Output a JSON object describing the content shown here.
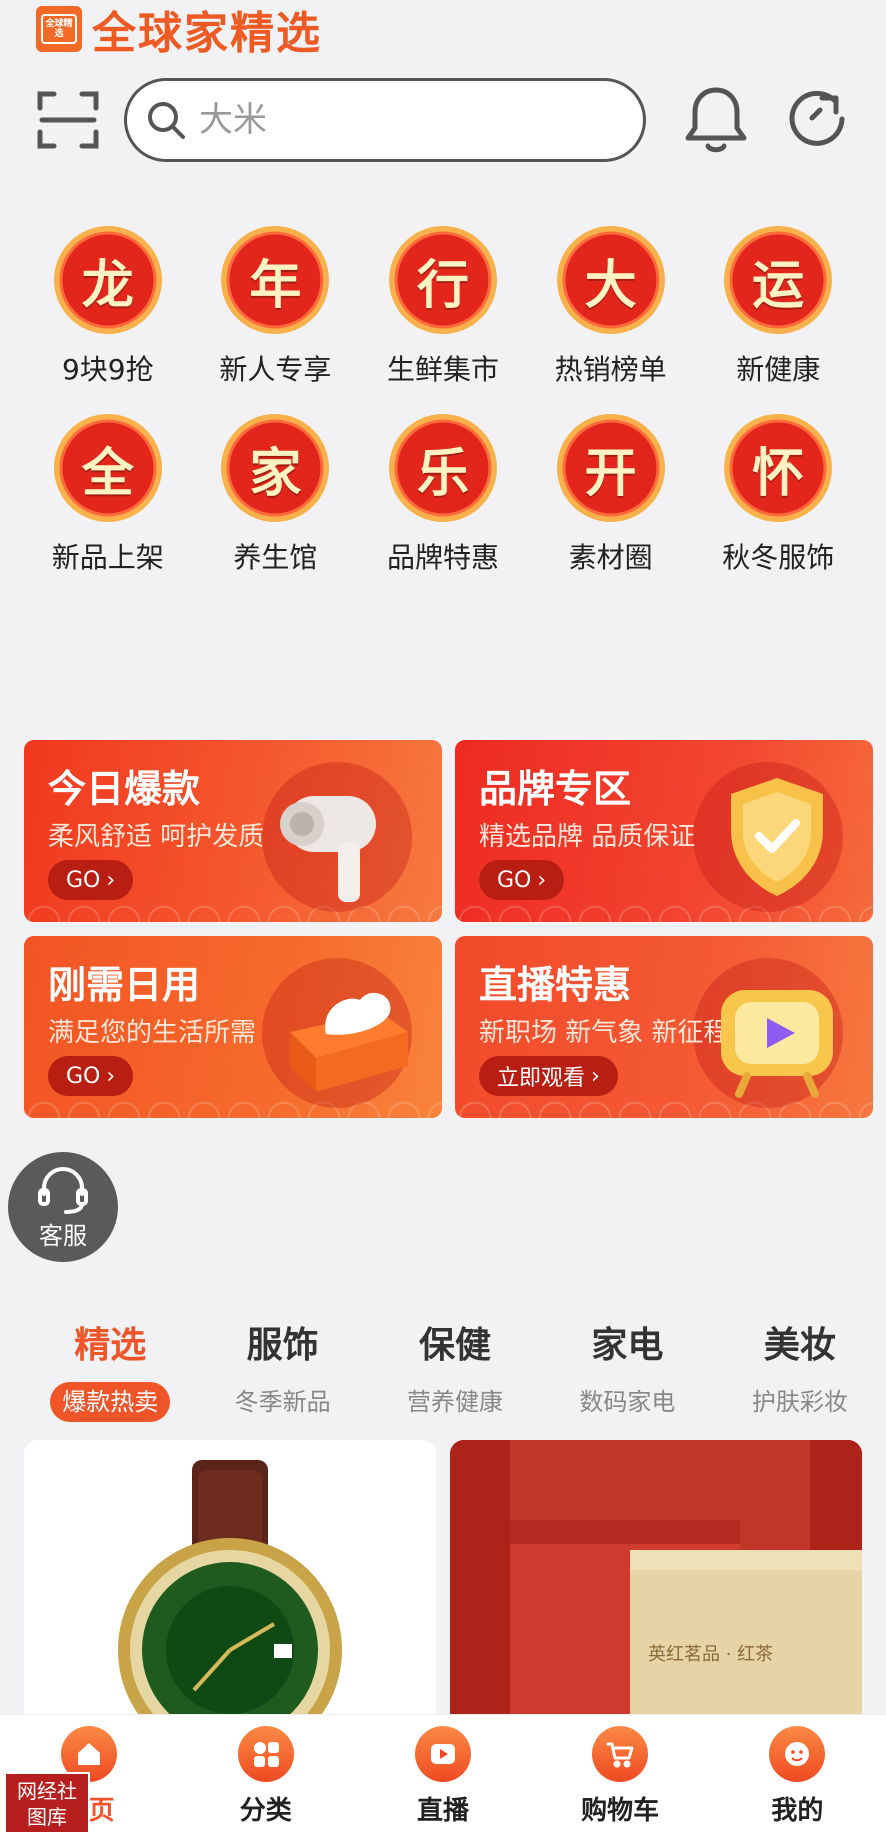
{
  "header": {
    "brand_logo_text": "全球精选",
    "brand_title": "全球家精选",
    "search_placeholder": "大米"
  },
  "categories": [
    {
      "char": "龙",
      "label": "9块9抢"
    },
    {
      "char": "年",
      "label": "新人专享"
    },
    {
      "char": "行",
      "label": "生鲜集市"
    },
    {
      "char": "大",
      "label": "热销榜单"
    },
    {
      "char": "运",
      "label": "新健康"
    },
    {
      "char": "全",
      "label": "新品上架"
    },
    {
      "char": "家",
      "label": "养生馆"
    },
    {
      "char": "乐",
      "label": "品牌特惠"
    },
    {
      "char": "开",
      "label": "素材圈"
    },
    {
      "char": "怀",
      "label": "秋冬服饰"
    }
  ],
  "promos": [
    {
      "title": "今日爆款",
      "subtitle": "柔风舒适 呵护发质",
      "button": "GO",
      "image_icon": "hair-dryer-icon"
    },
    {
      "title": "品牌专区",
      "subtitle": "精选品牌 品质保证",
      "button": "GO",
      "image_icon": "shield-check-icon"
    },
    {
      "title": "刚需日用",
      "subtitle": "满足您的生活所需",
      "button": "GO",
      "image_icon": "tissue-box-icon"
    },
    {
      "title": "直播特惠",
      "subtitle": "新职场 新气象 新征程",
      "button": "立即观看",
      "image_icon": "tv-play-icon"
    }
  ],
  "service": {
    "label": "客服"
  },
  "tabs": [
    {
      "title": "精选",
      "subtitle": "爆款热卖",
      "active": true
    },
    {
      "title": "服饰",
      "subtitle": "冬季新品"
    },
    {
      "title": "保健",
      "subtitle": "营养健康"
    },
    {
      "title": "家电",
      "subtitle": "数码家电"
    },
    {
      "title": "美妆",
      "subtitle": "护肤彩妆"
    }
  ],
  "products": {
    "left_image": "green-watch-image",
    "right_image": "red-tea-gift-box-image",
    "right_box_text": "英红茗品 · 红茶"
  },
  "bottom_nav": [
    {
      "label": "首页",
      "icon": "home-icon",
      "active": true
    },
    {
      "label": "分类",
      "icon": "category-icon"
    },
    {
      "label": "直播",
      "icon": "live-play-icon"
    },
    {
      "label": "购物车",
      "icon": "cart-icon"
    },
    {
      "label": "我的",
      "icon": "profile-icon"
    }
  ],
  "watermark": {
    "line1": "网经社",
    "line2": "图库"
  },
  "colors": {
    "accent": "#f0552a",
    "brand": "#ee5a24",
    "badge_red": "#e3261b"
  }
}
